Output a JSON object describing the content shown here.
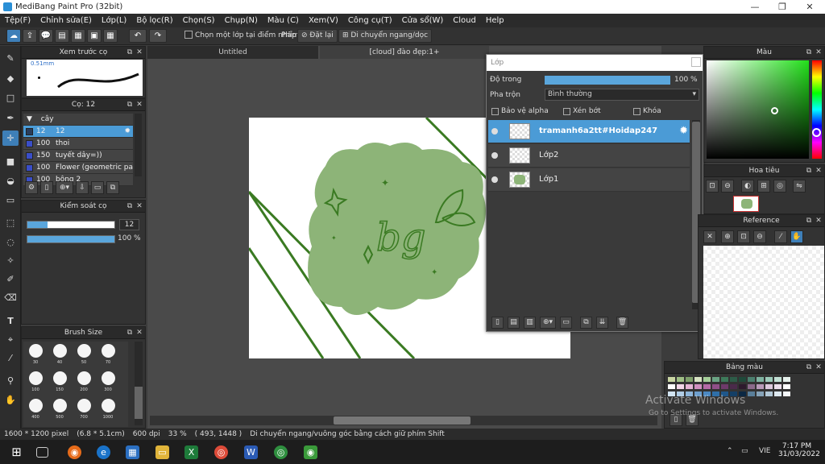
{
  "window": {
    "title": "MediBang Paint Pro (32bit)",
    "minimize": "—",
    "maximize": "❐",
    "close": "✕"
  },
  "menu": [
    "Tệp(F)",
    "Chỉnh sửa(E)",
    "Lớp(L)",
    "Bộ lọc(R)",
    "Chọn(S)",
    "Chụp(N)",
    "Màu (C)",
    "Xem(V)",
    "Công cụ(T)",
    "Cửa sổ(W)",
    "Cloud",
    "Help"
  ],
  "toolbar": {
    "undo": "↶",
    "redo": "↷",
    "select_one_layer": "Chọn một lớp tại điểm nhấp",
    "key_label": "Phím",
    "reset": "Đặt lại",
    "move_hv": "Di chuyển ngang/dọc"
  },
  "preview_panel": {
    "title": "Xem trước cọ",
    "size": "0.51mm"
  },
  "brush_panel": {
    "title": "Cọ: 12",
    "group": "cây",
    "items": [
      {
        "size": "12",
        "name": "12",
        "color": "#2a3d5a",
        "selected": true
      },
      {
        "size": "100",
        "name": "thoi",
        "color": "#3a4ec8",
        "selected": false
      },
      {
        "size": "150",
        "name": "tuyết dây=))",
        "color": "#3a4ec8",
        "selected": false
      },
      {
        "size": "100",
        "name": "Flower (geometric patt",
        "color": "#3a4ec8",
        "selected": false
      },
      {
        "size": "100",
        "name": "bông 2",
        "color": "#3a4ec8",
        "selected": false
      }
    ]
  },
  "control_panel": {
    "title": "Kiểm soát cọ",
    "size_value": "12",
    "opacity_value": "100 %",
    "size_fraction": 0.23,
    "opacity_fraction": 1.0
  },
  "brush_size_panel": {
    "title": "Brush Size",
    "sizes": [
      "30",
      "40",
      "50",
      "70",
      "100",
      "150",
      "200",
      "300",
      "400",
      "500",
      "700",
      "1000"
    ]
  },
  "canvas": {
    "tab_untitled": "Untitled",
    "tab_doc": "[cloud] đào đẹp:1+"
  },
  "layers": {
    "title": "Lớp",
    "opacity_label": "Độ trong",
    "opacity_value": "100 %",
    "opacity_fraction": 1.0,
    "blend_label": "Pha trộn",
    "blend_value": "Bình thường",
    "protect_alpha": "Bảo vệ alpha",
    "clipping": "Xén bớt",
    "lock": "Khóa",
    "items": [
      {
        "name": "tramanh6a2tt#Hoidap247",
        "selected": true
      },
      {
        "name": "Lớp2",
        "selected": false
      },
      {
        "name": "Lớp1",
        "selected": false
      }
    ]
  },
  "right": {
    "color_title": "Màu",
    "navigator_title": "Hoa tiêu",
    "reference_title": "Reference",
    "palette_title": "Bảng màu",
    "activate": "Activate Windows",
    "activate_sub": "Go to Settings to activate Windows."
  },
  "status": {
    "size": "1600 * 1200 pixel",
    "physical": "(6.8 * 5.1cm)",
    "dpi": "600 dpi",
    "zoom": "33 %",
    "coords": "( 493, 1448 )",
    "hint": "Di chuyển ngang/vuông góc bằng cách giữ phím Shift"
  },
  "taskbar": {
    "lang": "VIE",
    "time": "7:17 PM",
    "date": "31/03/2022"
  },
  "colors": {
    "accent": "#4b9bd6",
    "blob": "#8db478",
    "ink": "#3a7a22"
  }
}
